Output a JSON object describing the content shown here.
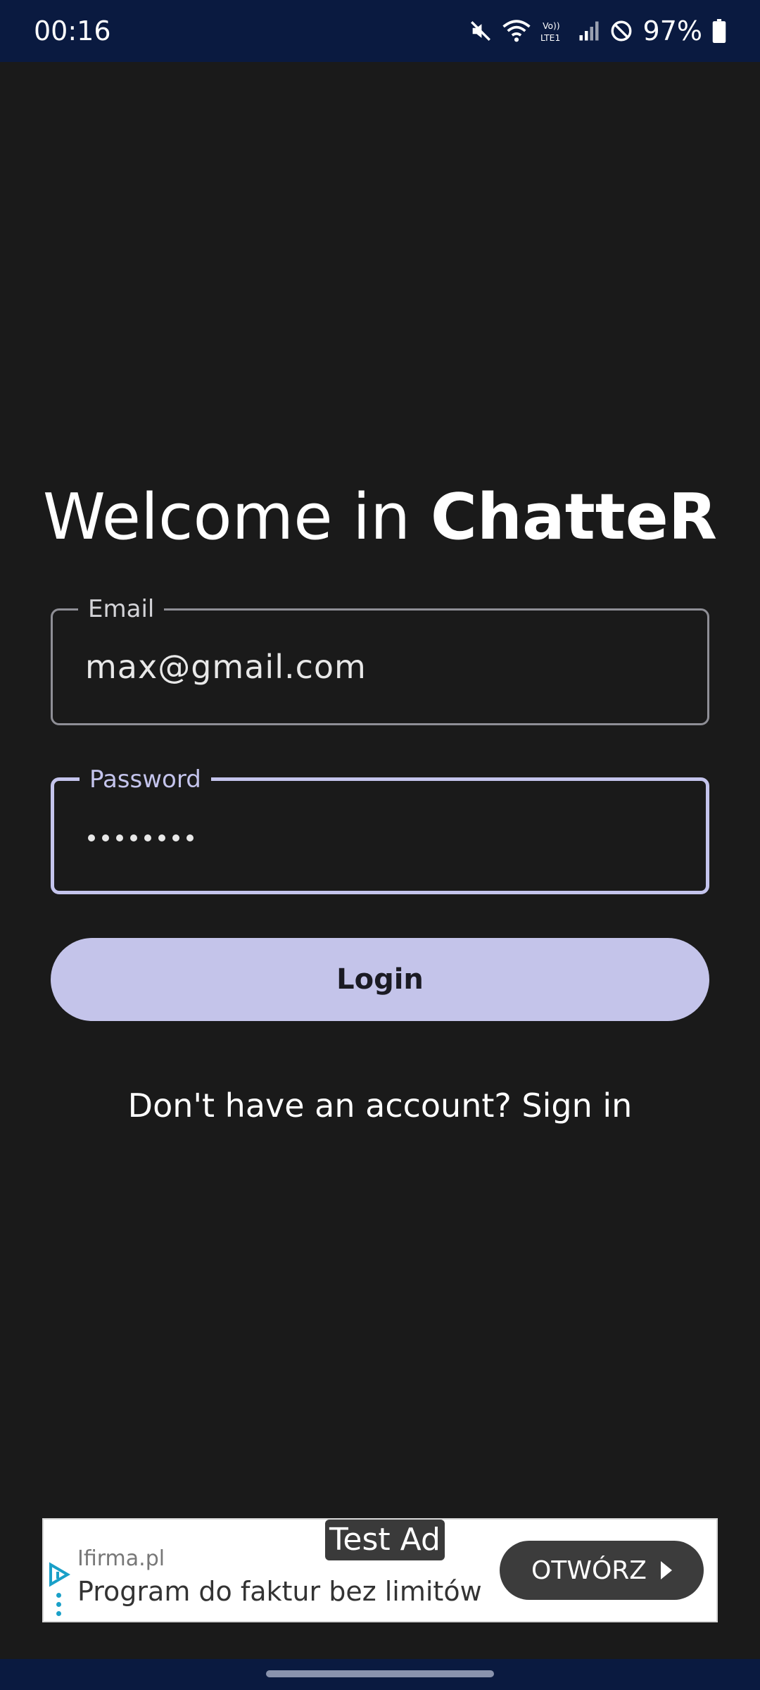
{
  "status_bar": {
    "time": "00:16",
    "battery": "97%",
    "icons": [
      "mute-icon",
      "wifi-icon",
      "volte-icon",
      "signal-icon",
      "dnd-icon",
      "battery-icon"
    ],
    "background": "#0a1a40"
  },
  "title": {
    "prefix": "Welcome in ",
    "brand": "ChatteR"
  },
  "email_field": {
    "label": "Email",
    "value": "max@gmail.com"
  },
  "password_field": {
    "label": "Password",
    "masked_length": 8,
    "focused": true,
    "accent": "#c4c4ec"
  },
  "login_button": {
    "label": "Login",
    "color": "#c4c4ea"
  },
  "signup_prompt": {
    "text": "Don't have an account? Sign in"
  },
  "ad": {
    "test_label": "Test Ad",
    "advertiser": "Ifirma.pl",
    "headline": "Program do faktur bez limitów",
    "cta": "OTWÓRZ"
  },
  "colors": {
    "background": "#1a1a1a",
    "text": "#ffffff"
  }
}
